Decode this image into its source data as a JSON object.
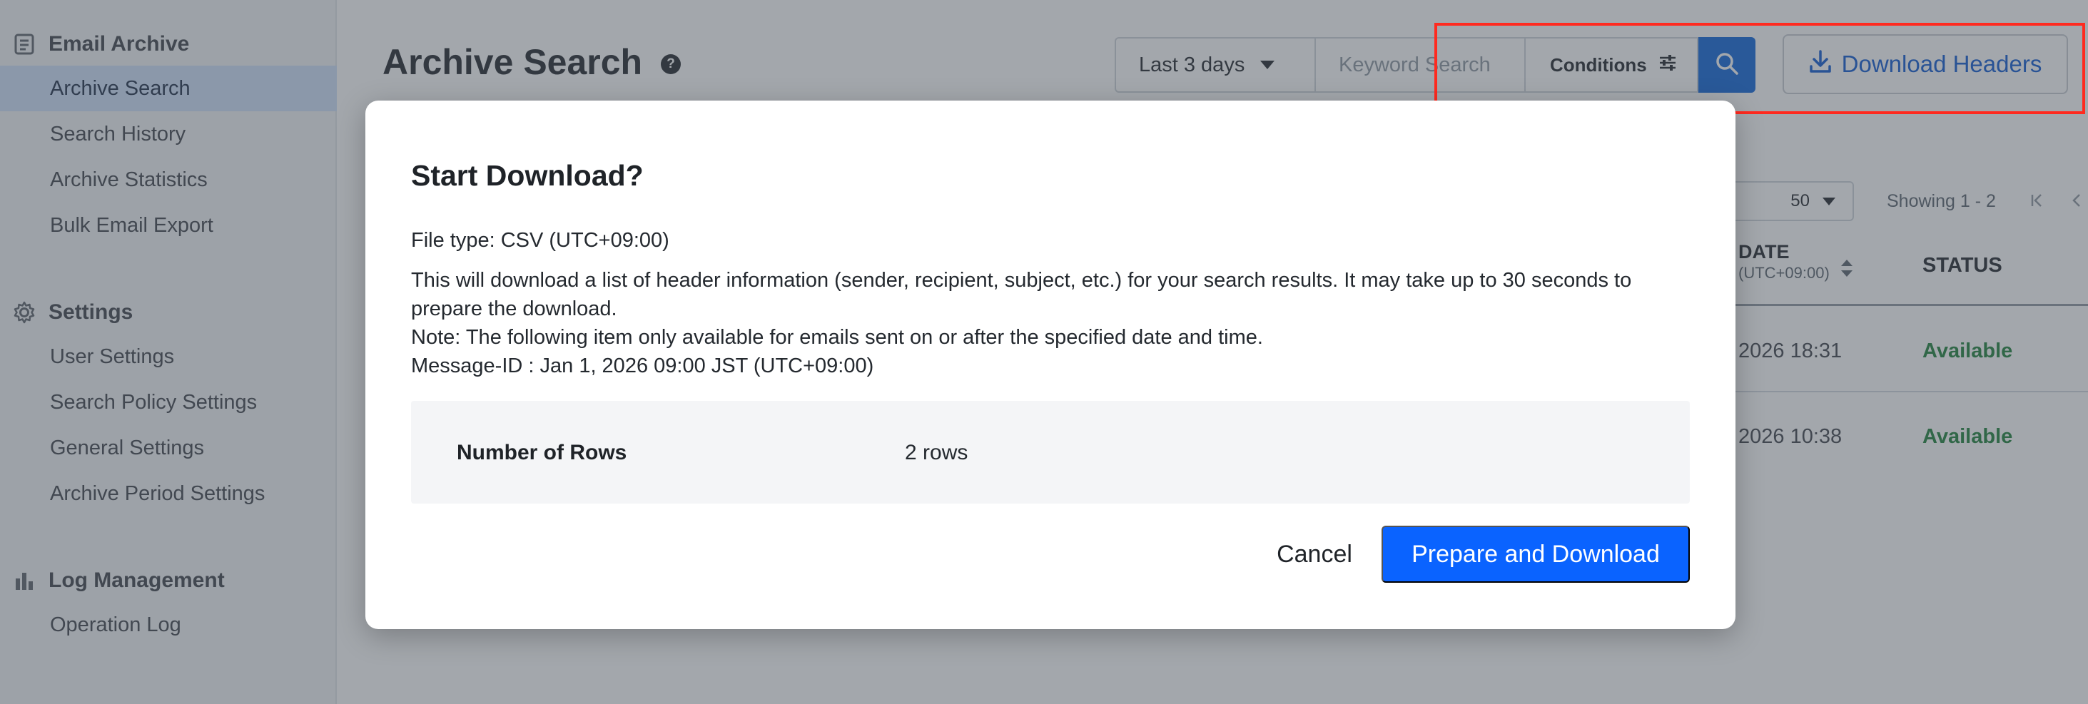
{
  "sidebar": {
    "email_archive": {
      "header": "Email Archive",
      "items": [
        "Archive Search",
        "Search History",
        "Archive Statistics",
        "Bulk Email Export"
      ]
    },
    "settings": {
      "header": "Settings",
      "items": [
        "User Settings",
        "Search Policy Settings",
        "General Settings",
        "Archive Period Settings"
      ]
    },
    "log_management": {
      "header": "Log Management",
      "items": [
        "Operation Log"
      ]
    },
    "active_item": "Archive Search"
  },
  "main": {
    "title": "Archive Search",
    "help_icon": "?",
    "search": {
      "period": "Last 3 days",
      "keyword_placeholder": "Keyword Search",
      "conditions_label": "Conditions"
    },
    "download_headers_label": "Download Headers",
    "pager": {
      "per_page": "50",
      "showing": "Showing 1 - 2"
    },
    "table": {
      "date_header": "DATE",
      "date_header_sub": "(UTC+09:00)",
      "status_header": "STATUS",
      "rows": [
        {
          "date": "2026 18:31",
          "status": "Available"
        },
        {
          "date": "2026 10:38",
          "status": "Available"
        }
      ]
    }
  },
  "dialog": {
    "title": "Start Download?",
    "file_type": "File type: CSV (UTC+09:00)",
    "body_lines": [
      "This will download a list of header information (sender, recipient, subject, etc.) for your search results. It may take up to 30 seconds to",
      "prepare the download.",
      "Note: The following item only available for emails sent on or after the specified date and time.",
      "Message-ID : Jan 1, 2026 09:00 JST (UTC+09:00)"
    ],
    "rows_label": "Number of Rows",
    "rows_value": "2 rows",
    "cancel_label": "Cancel",
    "confirm_label": "Prepare and Download"
  },
  "colors": {
    "accent": "#0a63ff",
    "highlight_border": "#ff2a1f",
    "status_available": "#1a7f37",
    "active_nav_bg": "#cfe0fb"
  },
  "icons": {
    "email_archive": "archive-icon",
    "settings": "gear-icon",
    "log_management": "bar-chart-icon",
    "search": "search-icon",
    "conditions": "sliders-icon",
    "download": "download-icon"
  }
}
